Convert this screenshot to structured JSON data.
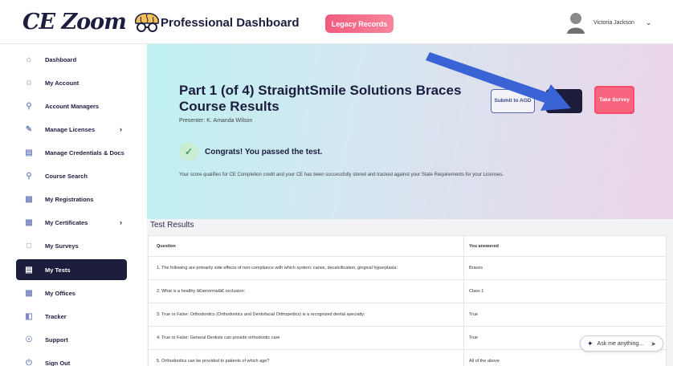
{
  "header": {
    "logo_text": "CE Zoom",
    "dashboard_title": "Professional Dashboard",
    "legacy_button": "Legacy Records",
    "user_name": "Victoria Jackson"
  },
  "sidebar": {
    "items": [
      {
        "label": "Dashboard",
        "icon": "home-icon"
      },
      {
        "label": "My Account",
        "icon": "account-icon"
      },
      {
        "label": "Account Managers",
        "icon": "managers-icon"
      },
      {
        "label": "Manage Licenses",
        "icon": "license-icon",
        "has_chevron": true
      },
      {
        "label": "Manage Credentials & Docs",
        "icon": "credentials-icon"
      },
      {
        "label": "Course Search",
        "icon": "search-icon"
      },
      {
        "label": "My Registrations",
        "icon": "registrations-icon"
      },
      {
        "label": "My Certificates",
        "icon": "certificate-icon",
        "has_chevron": true
      },
      {
        "label": "My Surveys",
        "icon": "survey-icon"
      },
      {
        "label": "My Tests",
        "icon": "tests-icon",
        "active": true
      },
      {
        "label": "My Offices",
        "icon": "offices-icon"
      },
      {
        "label": "Tracker",
        "icon": "tracker-icon"
      },
      {
        "label": "Support",
        "icon": "support-icon"
      },
      {
        "label": "Sign Out",
        "icon": "sign-out-icon"
      }
    ]
  },
  "hero": {
    "course_title": "Part 1 (of 4) StraightSmile Solutions Braces Course Results",
    "presenter": "Presenter: K. Amanda Wilson",
    "congrats": "Congrats! You passed the test.",
    "score_note": "Your score qualifies for CE Completion credit and your CE has been successfully stored and tracked against your State Requirements for your Licenses.",
    "submit_button": "Submit to AGD",
    "survey_button": "Take Survey"
  },
  "results": {
    "heading": "Test Results",
    "col_question": "Question",
    "col_answer": "You answered",
    "rows": [
      {
        "q": "1. The following are primarily side effects of non-compliance with which system: caries, decalcification, gingival hyperplasia:",
        "a": "Braces"
      },
      {
        "q": "2. What is a healthy â€œnormalâ€  occlusion:",
        "a": "Class 1"
      },
      {
        "q": "3. True or False: Orthodontics (Orthodontics and Dentofacial Orthopedics) is a recognized dental specialty:",
        "a": "True"
      },
      {
        "q": "4. True or False: General Dentists can provide orthodontic care",
        "a": "True"
      },
      {
        "q": "5. Orthodontics can be provided to patients of which age?",
        "a": "All of the above"
      }
    ]
  },
  "assistant": {
    "label": "Ask me anything..."
  },
  "colors": {
    "navy": "#1c1c3c",
    "accent_pink": "#f7657f",
    "annotation_arrow": "#3a63d6"
  }
}
